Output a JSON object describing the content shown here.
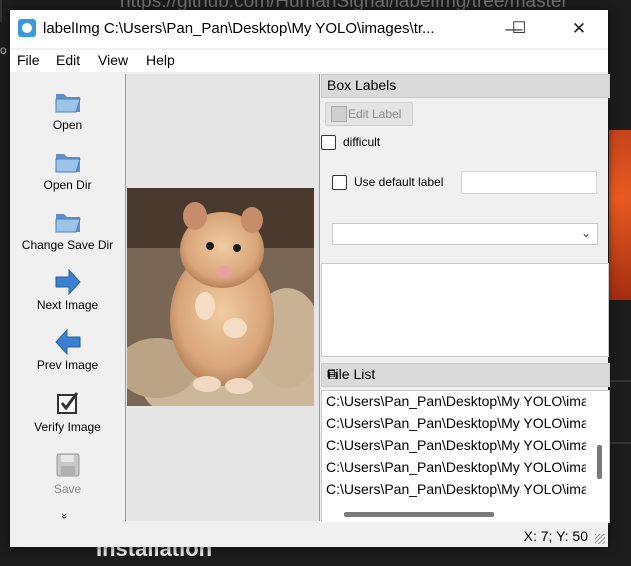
{
  "background": {
    "url_text": "https://github.com/HumanSignal/labelImg/tree/master",
    "heading_text": "Installation",
    "edge_letter": "o"
  },
  "window": {
    "title": "labelImg C:\\Users\\Pan_Pan\\Desktop\\My YOLO\\images\\tr...",
    "controls": {
      "minimize": "—",
      "maximize": "☐",
      "close": "✕"
    }
  },
  "menu": [
    "File",
    "Edit",
    "View",
    "Help"
  ],
  "toolbar": {
    "items": [
      {
        "label": "Open",
        "icon": "folder-open-icon",
        "enabled": true
      },
      {
        "label": "Open Dir",
        "icon": "folder-open-icon",
        "enabled": true
      },
      {
        "label": "Change Save Dir",
        "icon": "folder-open-icon",
        "enabled": true
      },
      {
        "label": "Next Image",
        "icon": "arrow-right-icon",
        "enabled": true
      },
      {
        "label": "Prev Image",
        "icon": "arrow-left-icon",
        "enabled": true
      },
      {
        "label": "Verify Image",
        "icon": "checkbox-check-icon",
        "enabled": true
      },
      {
        "label": "Save",
        "icon": "floppy-disk-icon",
        "enabled": false
      }
    ],
    "more": "»"
  },
  "box_labels": {
    "title": "Box Labels",
    "edit_label": "Edit Label",
    "difficult": "difficult",
    "use_default_label": "Use default label",
    "default_label_value": "",
    "combo_value": ""
  },
  "file_list": {
    "title": "File List",
    "float_icon": "⧉",
    "files": [
      "C:\\Users\\Pan_Pan\\Desktop\\My YOLO\\images",
      "C:\\Users\\Pan_Pan\\Desktop\\My YOLO\\images",
      "C:\\Users\\Pan_Pan\\Desktop\\My YOLO\\images",
      "C:\\Users\\Pan_Pan\\Desktop\\My YOLO\\images",
      "C:\\Users\\Pan_Pan\\Desktop\\My YOLO\\images"
    ]
  },
  "status": {
    "coords": "X: 7; Y: 50"
  },
  "colors": {
    "accent_blue": "#3a7fd0",
    "folder_blue": "#8fb8e0",
    "photo_bg": "#b59a80"
  }
}
